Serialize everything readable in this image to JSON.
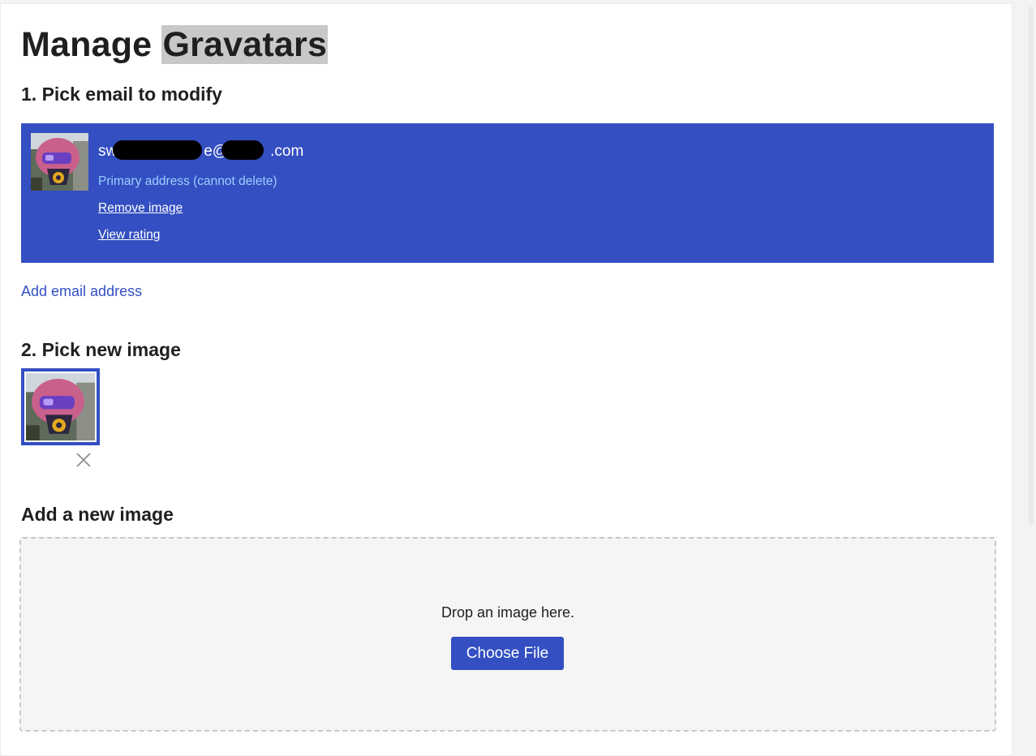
{
  "header": {
    "title_prefix": "Manage",
    "title_highlight": "Gravatars"
  },
  "section_pick_email": {
    "heading": "1. Pick email to modify",
    "email": {
      "parts": [
        "sw",
        "e@",
        ".com"
      ],
      "note": "Primary address (cannot delete)",
      "remove_image_label": "Remove image",
      "view_rating_label": "View rating"
    },
    "add_email_label": "Add email address"
  },
  "section_pick_image": {
    "heading": "2. Pick new image",
    "remove_icon": "close-icon"
  },
  "section_add_image": {
    "heading": "Add a new image",
    "drop_text": "Drop an image here.",
    "choose_file_label": "Choose File"
  },
  "colors": {
    "accent": "#334fc1",
    "note": "#9ad0ff",
    "dropzone_bg": "#f5f5f5"
  }
}
